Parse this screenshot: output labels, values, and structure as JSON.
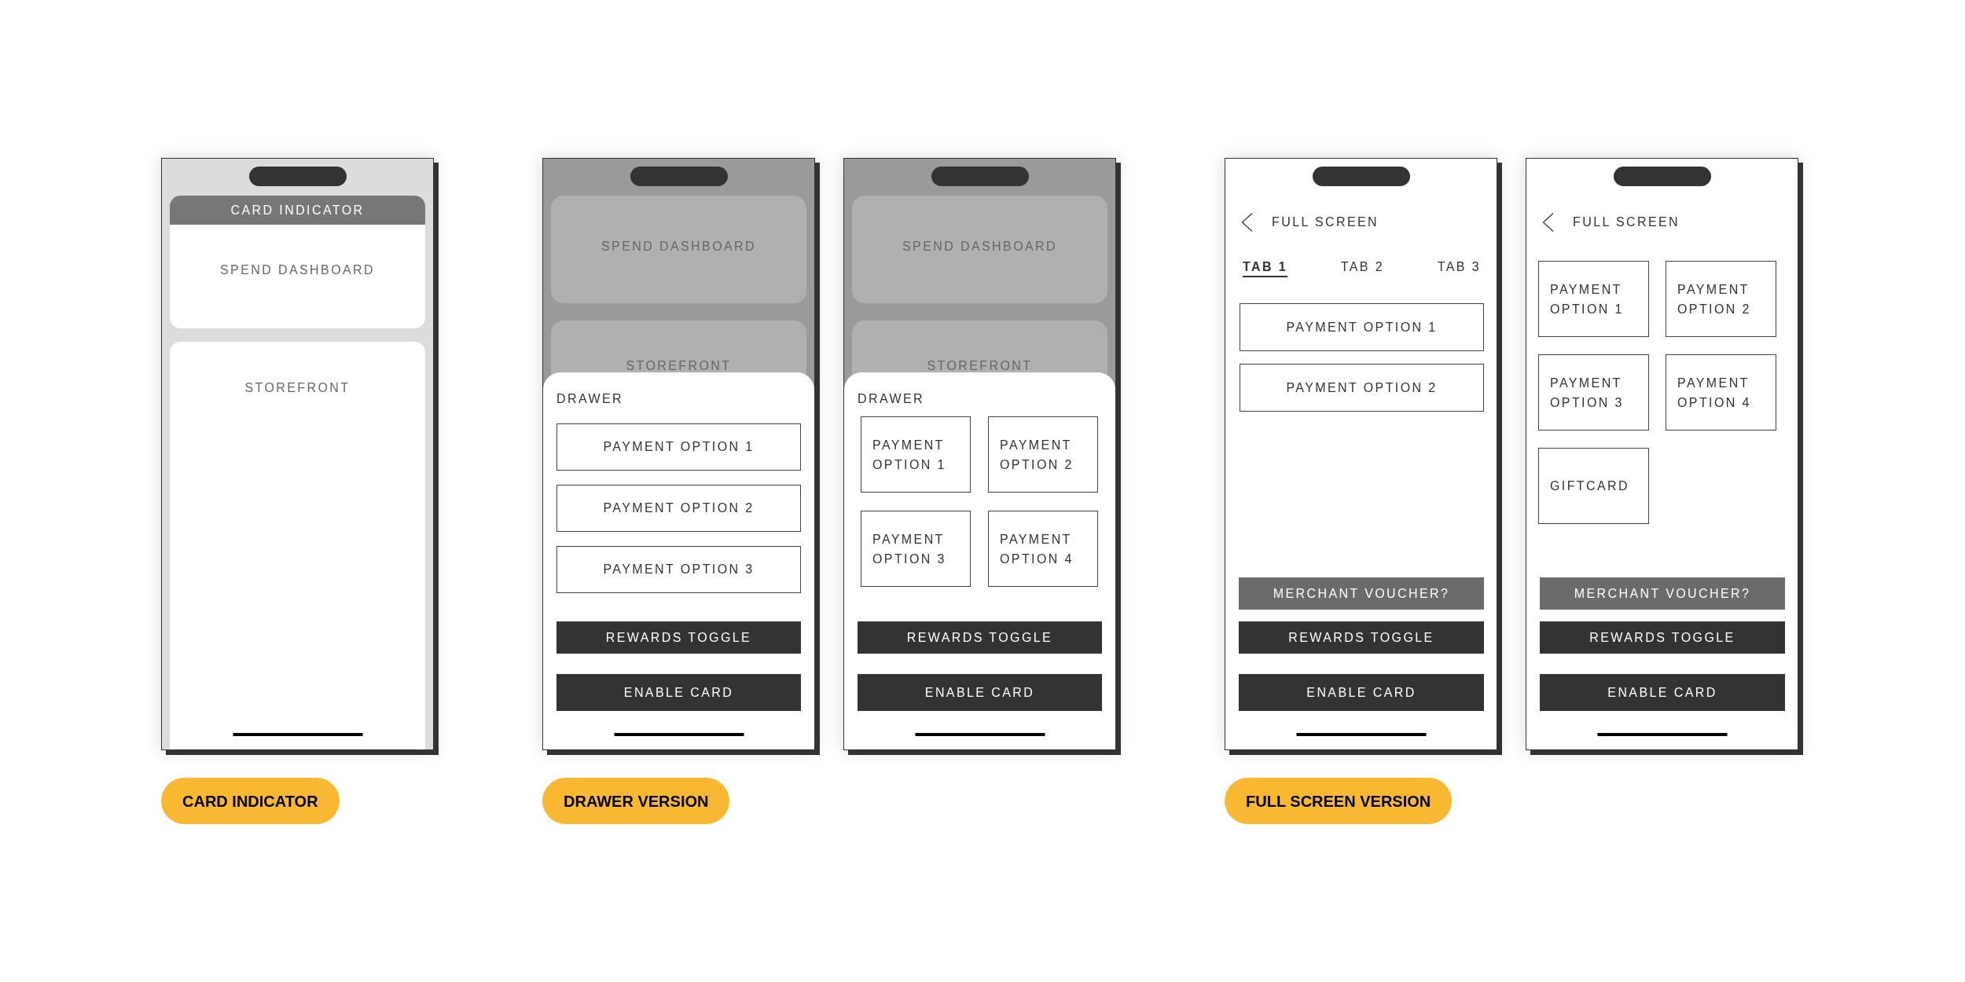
{
  "sections": [
    {
      "label": "CARD INDICATOR",
      "phones": [
        {
          "kind": "card_indicator",
          "indicator": "CARD INDICATOR",
          "cards": [
            "SPEND DASHBOARD",
            "STOREFRONT"
          ]
        }
      ]
    },
    {
      "label": "DRAWER VERSION",
      "phones": [
        {
          "kind": "drawer",
          "background_cards": [
            "SPEND DASHBOARD",
            "STOREFRONT"
          ],
          "drawer": {
            "title": "DRAWER",
            "option_rows": [
              "PAYMENT OPTION 1",
              "PAYMENT OPTION 2",
              "PAYMENT OPTION 3"
            ],
            "buttons": [
              {
                "kind": "toggle",
                "label": "REWARDS TOGGLE"
              },
              {
                "kind": "primary",
                "label": "ENABLE CARD"
              }
            ]
          }
        },
        {
          "kind": "drawer",
          "background_cards": [
            "SPEND DASHBOARD",
            "STOREFRONT"
          ],
          "drawer": {
            "title": "DRAWER",
            "option_tiles": [
              "PAYMENT OPTION 1",
              "PAYMENT OPTION 2",
              "PAYMENT OPTION 3",
              "PAYMENT OPTION 4"
            ],
            "buttons": [
              {
                "kind": "toggle",
                "label": "REWARDS TOGGLE"
              },
              {
                "kind": "primary",
                "label": "ENABLE CARD"
              }
            ]
          }
        }
      ]
    },
    {
      "label": "FULL SCREEN VERSION",
      "phones": [
        {
          "kind": "full_screen",
          "title": "FULL SCREEN",
          "tabs": [
            {
              "label": "TAB 1",
              "selected": true
            },
            {
              "label": "TAB 2",
              "selected": false
            },
            {
              "label": "TAB 3",
              "selected": false
            }
          ],
          "option_rows": [
            "PAYMENT OPTION 1",
            "PAYMENT OPTION 2"
          ],
          "buttons": [
            {
              "kind": "secondary",
              "label": "MERCHANT VOUCHER?"
            },
            {
              "kind": "toggle",
              "label": "REWARDS TOGGLE"
            },
            {
              "kind": "primary",
              "label": "ENABLE CARD"
            }
          ]
        },
        {
          "kind": "full_screen",
          "title": "FULL SCREEN",
          "option_tiles": [
            "PAYMENT OPTION 1",
            "PAYMENT OPTION 2",
            "PAYMENT OPTION 3",
            "PAYMENT OPTION 4",
            "GIFTCARD"
          ],
          "buttons": [
            {
              "kind": "secondary",
              "label": "MERCHANT VOUCHER?"
            },
            {
              "kind": "toggle",
              "label": "REWARDS TOGGLE"
            },
            {
              "kind": "primary",
              "label": "ENABLE CARD"
            }
          ]
        }
      ]
    }
  ]
}
